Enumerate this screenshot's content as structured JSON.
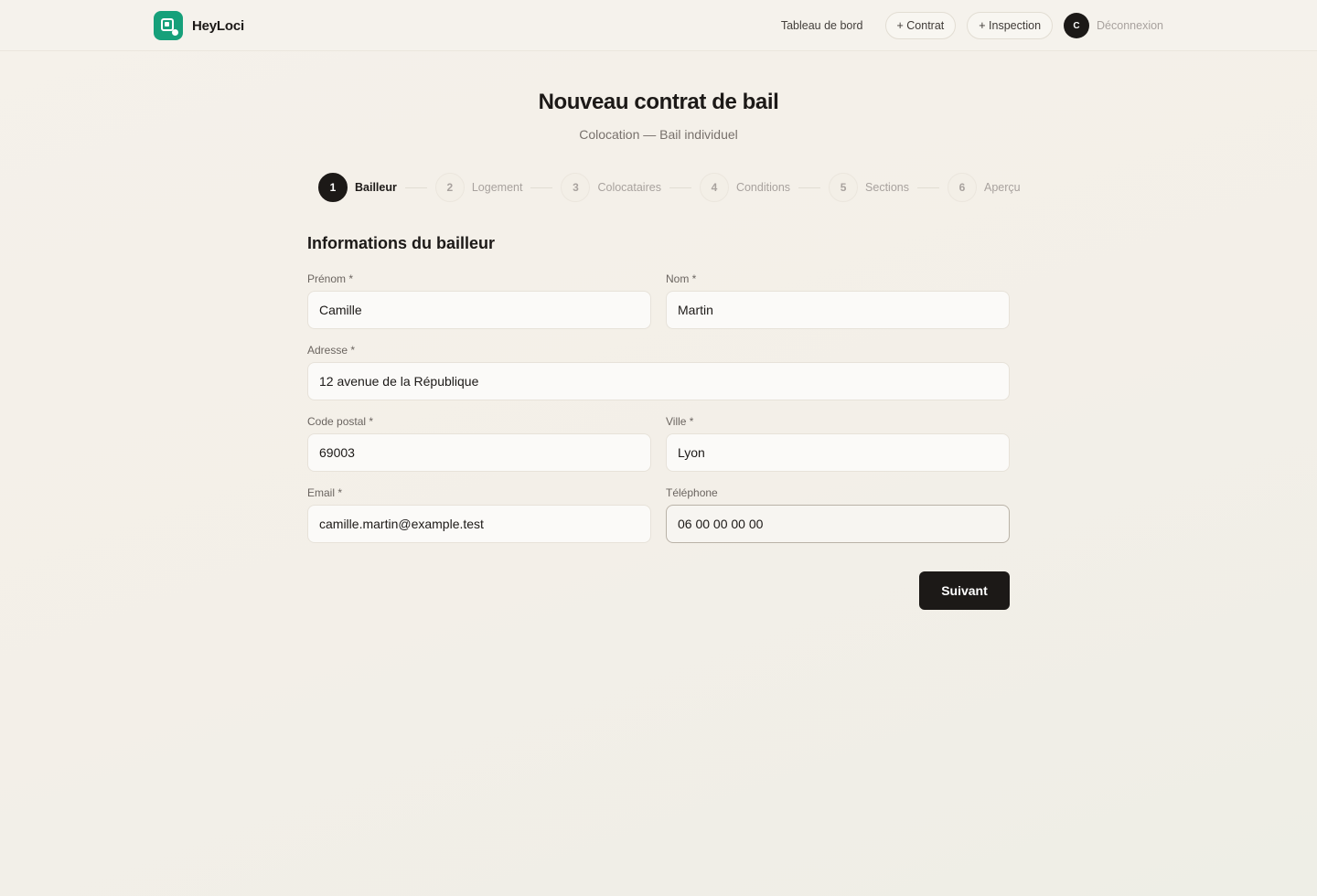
{
  "app": {
    "name": "HeyLoci"
  },
  "nav": {
    "dashboard": "Tableau de bord",
    "new_contract": "+ Contrat",
    "new_inspection": "+ Inspection",
    "avatar_initial": "C",
    "logout": "Déconnexion"
  },
  "page": {
    "title": "Nouveau contrat de bail",
    "subtitle": "Colocation — Bail individuel"
  },
  "steps": [
    {
      "number": "1",
      "label": "Bailleur",
      "active": true
    },
    {
      "number": "2",
      "label": "Logement",
      "active": false
    },
    {
      "number": "3",
      "label": "Colocataires",
      "active": false
    },
    {
      "number": "4",
      "label": "Conditions",
      "active": false
    },
    {
      "number": "5",
      "label": "Sections",
      "active": false
    },
    {
      "number": "6",
      "label": "Aperçu",
      "active": false
    }
  ],
  "form": {
    "section_title": "Informations du bailleur",
    "first_name": {
      "label": "Prénom *",
      "value": "Camille"
    },
    "last_name": {
      "label": "Nom *",
      "value": "Martin"
    },
    "address": {
      "label": "Adresse *",
      "value": "12 avenue de la République"
    },
    "postal_code": {
      "label": "Code postal *",
      "value": "69003"
    },
    "city": {
      "label": "Ville *",
      "value": "Lyon"
    },
    "email": {
      "label": "Email *",
      "value": "camille.martin@example.test"
    },
    "phone": {
      "label": "Téléphone",
      "value": "06 00 00 00 00"
    },
    "submit_label": "Suivant"
  },
  "colors": {
    "brand": "#16a07a",
    "primary": "#1c1917",
    "background": "#f5f1ea"
  }
}
